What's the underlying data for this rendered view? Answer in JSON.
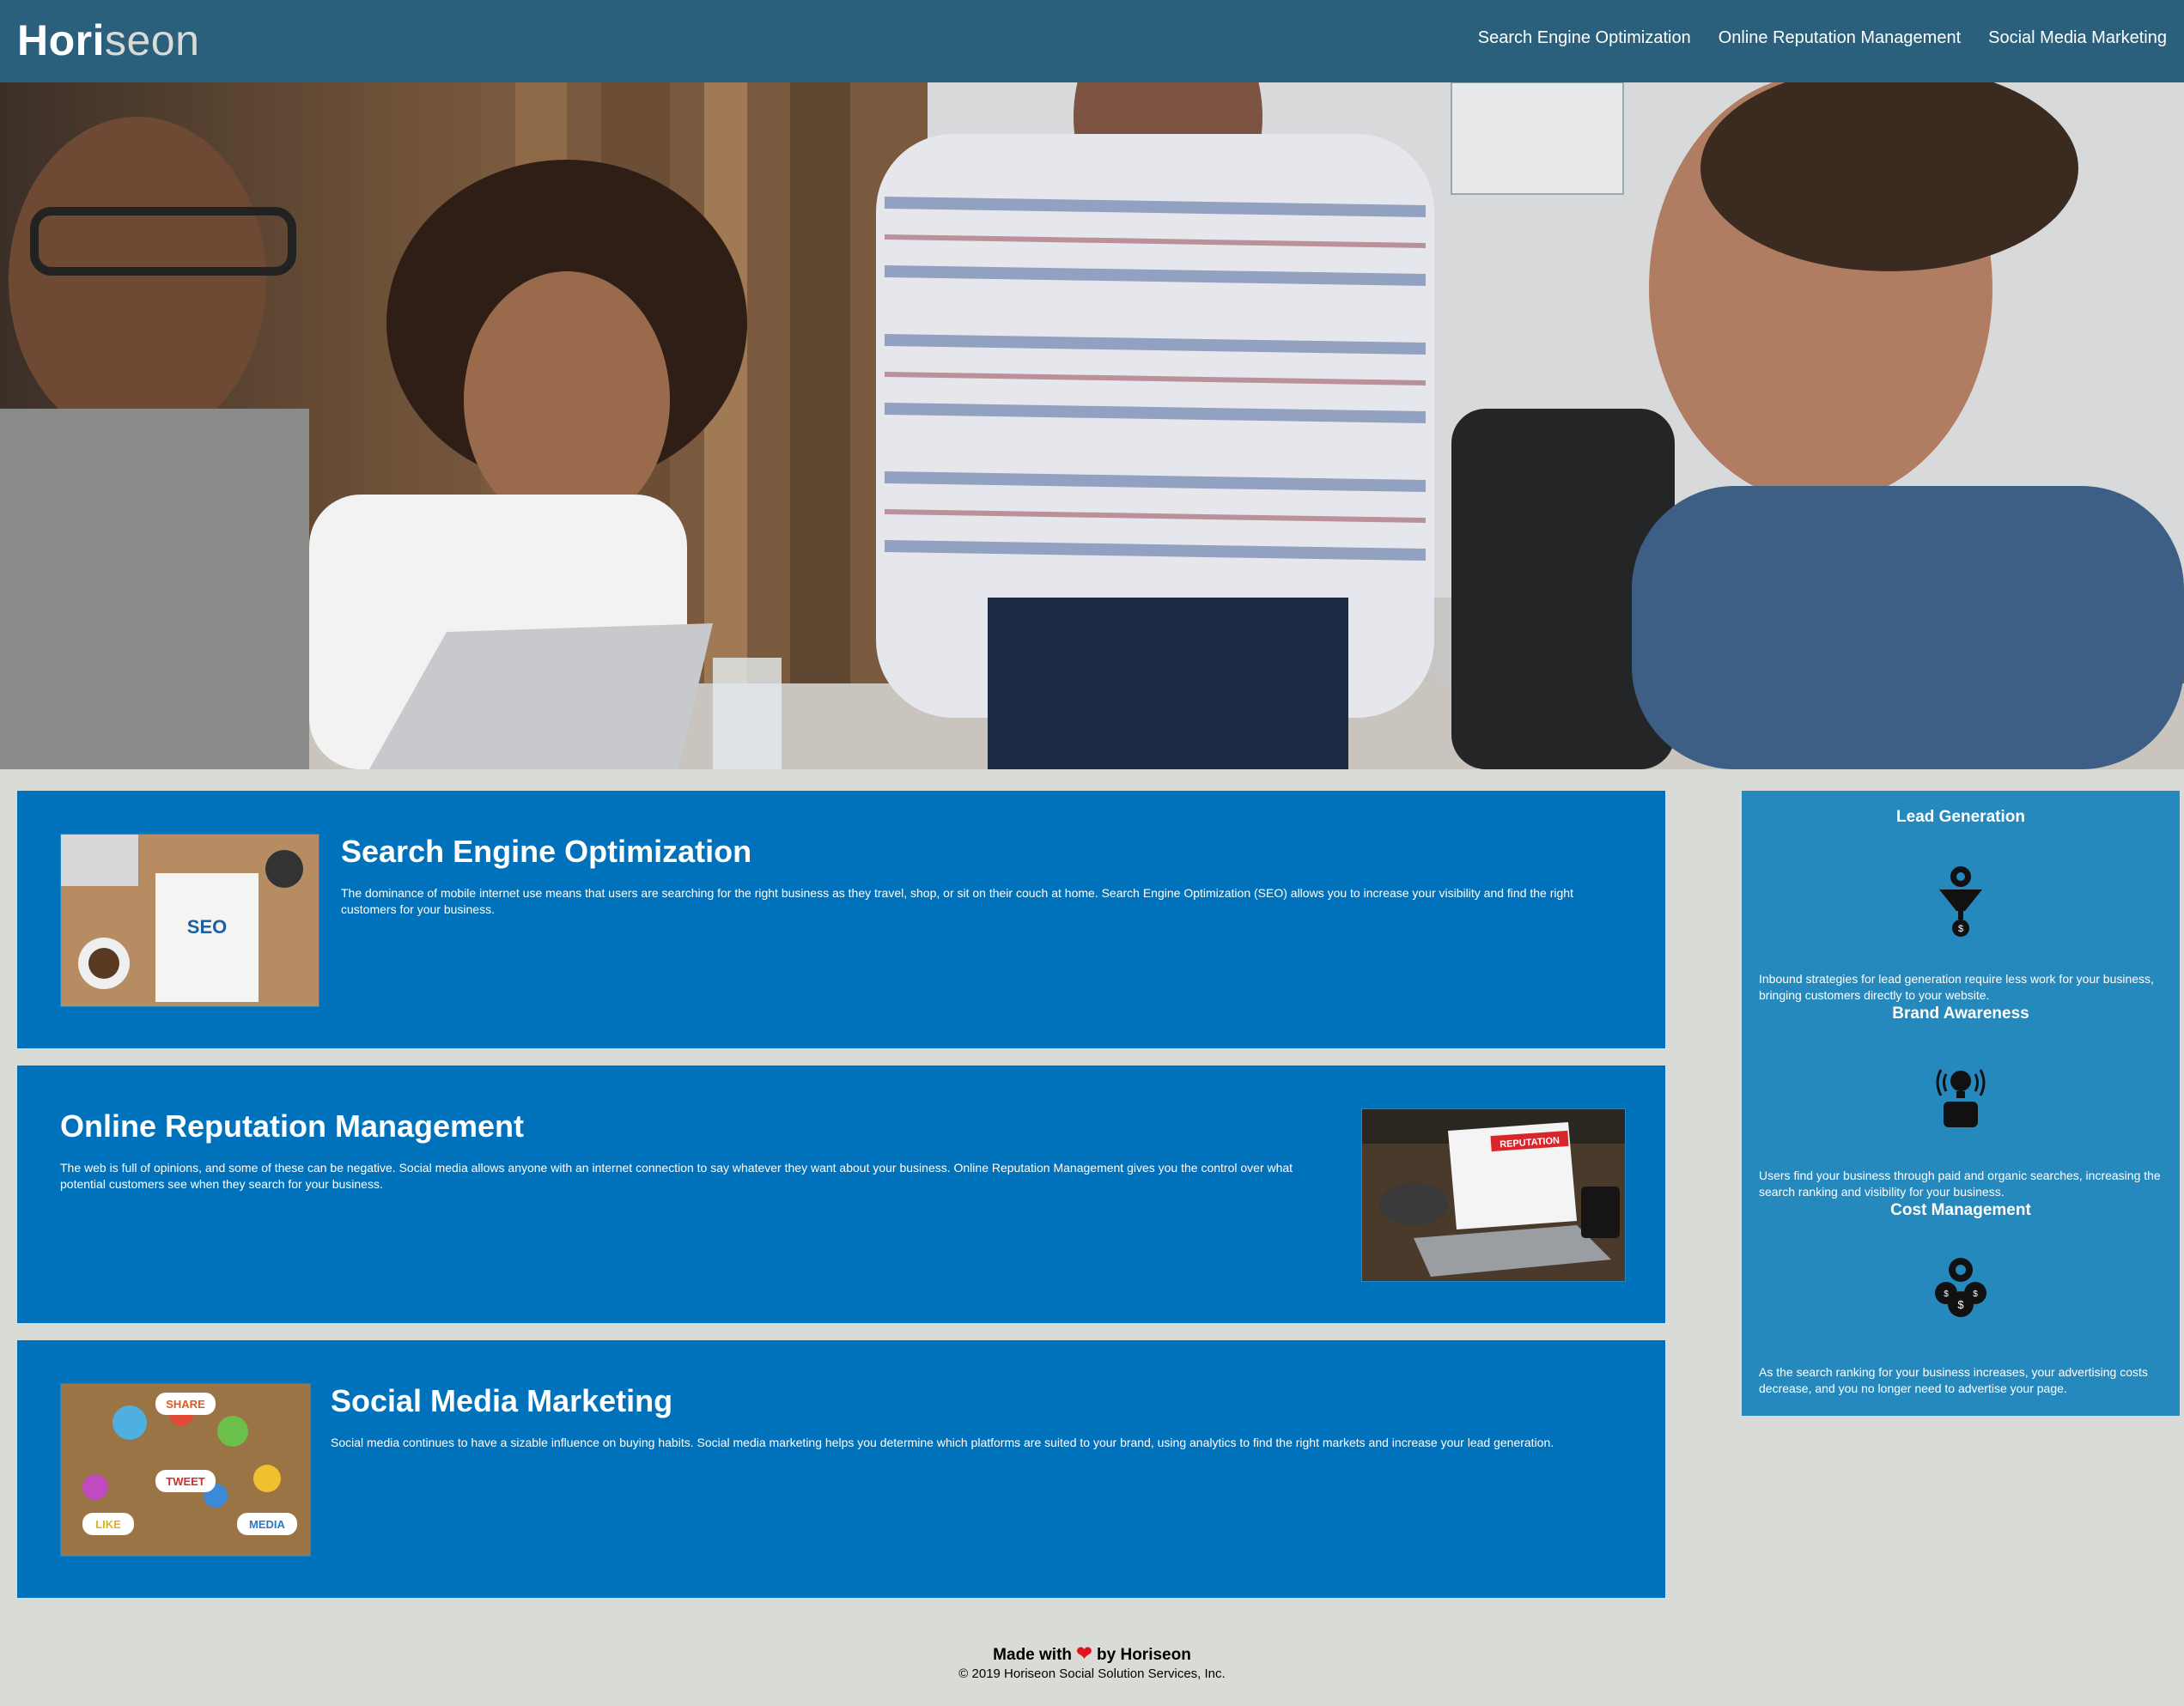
{
  "header": {
    "logo_main": "Hori",
    "logo_accent": "seon",
    "nav": [
      {
        "label": "Search Engine Optimization"
      },
      {
        "label": "Online Reputation Management"
      },
      {
        "label": "Social Media Marketing"
      }
    ]
  },
  "hero": {
    "image": "team-meeting-photo"
  },
  "cards": [
    {
      "title": "Search Engine Optimization",
      "text": "The dominance of mobile internet use means that users are searching for the right business as they travel, shop, or sit on their couch at home. Search Engine Optimization (SEO) allows you to increase your visibility and find the right customers for your business.",
      "image": "seo-notebook-image",
      "image_text": "SEO"
    },
    {
      "title": "Online Reputation Management",
      "text": "The web is full of opinions, and some of these can be negative. Social media allows anyone with an internet connection to say whatever they want about your business. Online Reputation Management gives you the control over what potential customers see when they search for your business.",
      "image": "reputation-laptop-image",
      "image_text": "REPUTATION"
    },
    {
      "title": "Social Media Marketing",
      "text": "Social media continues to have a sizable influence on buying habits. Social media marketing helps you determine which platforms are suited to your brand, using analytics to find the right markets and increase your lead generation.",
      "image": "social-media-image",
      "image_words": [
        "SHARE",
        "TWEET",
        "LIKE",
        "MEDIA"
      ]
    }
  ],
  "sidebar": [
    {
      "title": "Lead Generation",
      "icon": "funnel-gear-icon",
      "text": "Inbound strategies for lead generation require less work for your business, bringing customers directly to your website."
    },
    {
      "title": "Brand Awareness",
      "icon": "lightbulb-broadcast-icon",
      "text": "Users find your business through paid and organic searches, increasing the search ranking and visibility for your business."
    },
    {
      "title": "Cost Management",
      "icon": "coins-gear-icon",
      "text": "As the search ranking for your business increases, your advertising costs decrease, and you no longer need to advertise your page."
    }
  ],
  "footer": {
    "made_prefix": "Made with",
    "heart": "❤",
    "made_suffix": "by Horiseon",
    "copyright": "© 2019 Horiseon Social Solution Services, Inc."
  },
  "colors": {
    "header": "#2a607c",
    "card": "#0072bb",
    "sidebar": "#2589bd",
    "background": "#d9dcd6"
  }
}
